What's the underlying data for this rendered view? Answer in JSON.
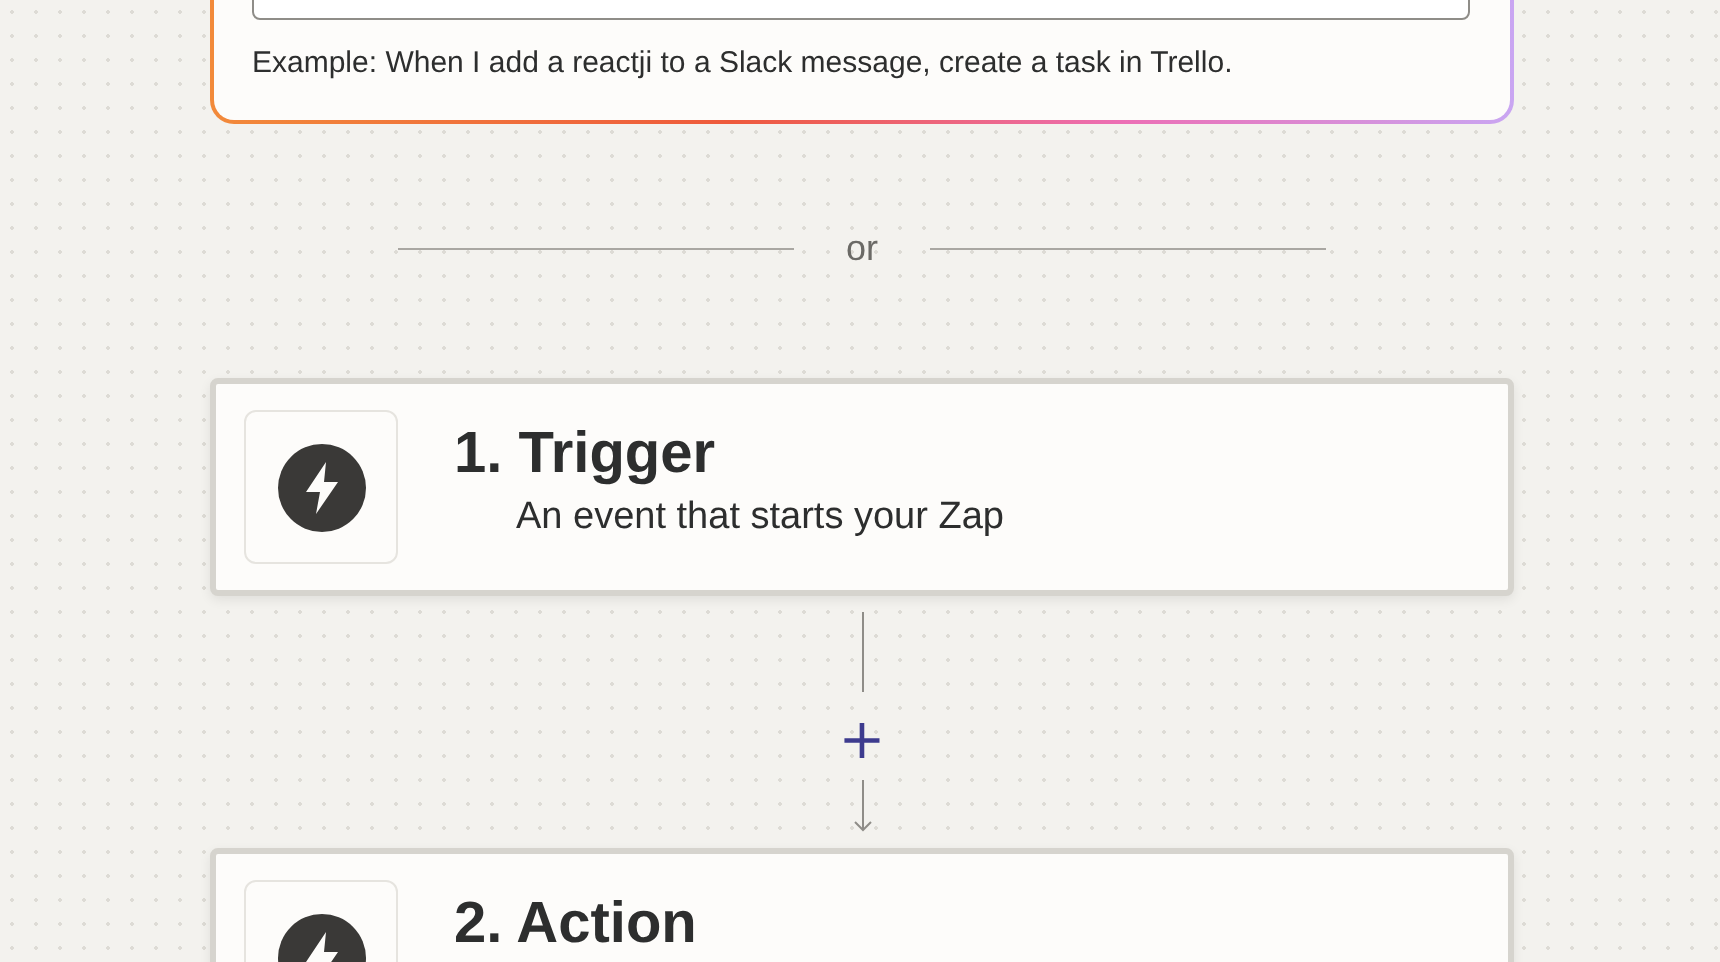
{
  "prompt_card": {
    "example": "Example: When I add a reactji to a Slack message, create a task in Trello."
  },
  "divider": {
    "label": "or"
  },
  "steps": [
    {
      "title": "1. Trigger",
      "subtitle": "An event that starts your Zap"
    },
    {
      "title": "2. Action"
    }
  ],
  "add_step": {
    "label": "+"
  }
}
